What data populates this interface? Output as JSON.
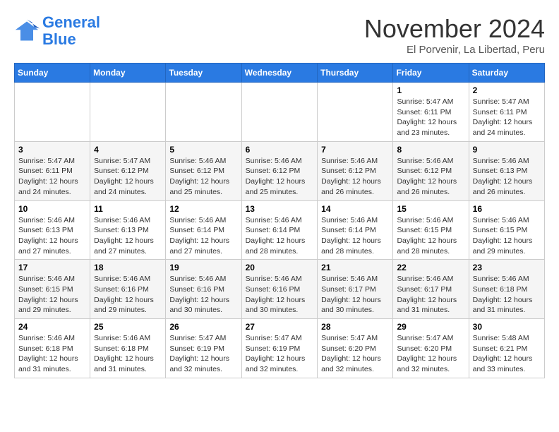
{
  "logo": {
    "line1": "General",
    "line2": "Blue"
  },
  "title": "November 2024",
  "subtitle": "El Porvenir, La Libertad, Peru",
  "days_of_week": [
    "Sunday",
    "Monday",
    "Tuesday",
    "Wednesday",
    "Thursday",
    "Friday",
    "Saturday"
  ],
  "weeks": [
    [
      {
        "day": "",
        "info": ""
      },
      {
        "day": "",
        "info": ""
      },
      {
        "day": "",
        "info": ""
      },
      {
        "day": "",
        "info": ""
      },
      {
        "day": "",
        "info": ""
      },
      {
        "day": "1",
        "info": "Sunrise: 5:47 AM\nSunset: 6:11 PM\nDaylight: 12 hours and 23 minutes."
      },
      {
        "day": "2",
        "info": "Sunrise: 5:47 AM\nSunset: 6:11 PM\nDaylight: 12 hours and 24 minutes."
      }
    ],
    [
      {
        "day": "3",
        "info": "Sunrise: 5:47 AM\nSunset: 6:11 PM\nDaylight: 12 hours and 24 minutes."
      },
      {
        "day": "4",
        "info": "Sunrise: 5:47 AM\nSunset: 6:12 PM\nDaylight: 12 hours and 24 minutes."
      },
      {
        "day": "5",
        "info": "Sunrise: 5:46 AM\nSunset: 6:12 PM\nDaylight: 12 hours and 25 minutes."
      },
      {
        "day": "6",
        "info": "Sunrise: 5:46 AM\nSunset: 6:12 PM\nDaylight: 12 hours and 25 minutes."
      },
      {
        "day": "7",
        "info": "Sunrise: 5:46 AM\nSunset: 6:12 PM\nDaylight: 12 hours and 26 minutes."
      },
      {
        "day": "8",
        "info": "Sunrise: 5:46 AM\nSunset: 6:12 PM\nDaylight: 12 hours and 26 minutes."
      },
      {
        "day": "9",
        "info": "Sunrise: 5:46 AM\nSunset: 6:13 PM\nDaylight: 12 hours and 26 minutes."
      }
    ],
    [
      {
        "day": "10",
        "info": "Sunrise: 5:46 AM\nSunset: 6:13 PM\nDaylight: 12 hours and 27 minutes."
      },
      {
        "day": "11",
        "info": "Sunrise: 5:46 AM\nSunset: 6:13 PM\nDaylight: 12 hours and 27 minutes."
      },
      {
        "day": "12",
        "info": "Sunrise: 5:46 AM\nSunset: 6:14 PM\nDaylight: 12 hours and 27 minutes."
      },
      {
        "day": "13",
        "info": "Sunrise: 5:46 AM\nSunset: 6:14 PM\nDaylight: 12 hours and 28 minutes."
      },
      {
        "day": "14",
        "info": "Sunrise: 5:46 AM\nSunset: 6:14 PM\nDaylight: 12 hours and 28 minutes."
      },
      {
        "day": "15",
        "info": "Sunrise: 5:46 AM\nSunset: 6:15 PM\nDaylight: 12 hours and 28 minutes."
      },
      {
        "day": "16",
        "info": "Sunrise: 5:46 AM\nSunset: 6:15 PM\nDaylight: 12 hours and 29 minutes."
      }
    ],
    [
      {
        "day": "17",
        "info": "Sunrise: 5:46 AM\nSunset: 6:15 PM\nDaylight: 12 hours and 29 minutes."
      },
      {
        "day": "18",
        "info": "Sunrise: 5:46 AM\nSunset: 6:16 PM\nDaylight: 12 hours and 29 minutes."
      },
      {
        "day": "19",
        "info": "Sunrise: 5:46 AM\nSunset: 6:16 PM\nDaylight: 12 hours and 30 minutes."
      },
      {
        "day": "20",
        "info": "Sunrise: 5:46 AM\nSunset: 6:16 PM\nDaylight: 12 hours and 30 minutes."
      },
      {
        "day": "21",
        "info": "Sunrise: 5:46 AM\nSunset: 6:17 PM\nDaylight: 12 hours and 30 minutes."
      },
      {
        "day": "22",
        "info": "Sunrise: 5:46 AM\nSunset: 6:17 PM\nDaylight: 12 hours and 31 minutes."
      },
      {
        "day": "23",
        "info": "Sunrise: 5:46 AM\nSunset: 6:18 PM\nDaylight: 12 hours and 31 minutes."
      }
    ],
    [
      {
        "day": "24",
        "info": "Sunrise: 5:46 AM\nSunset: 6:18 PM\nDaylight: 12 hours and 31 minutes."
      },
      {
        "day": "25",
        "info": "Sunrise: 5:46 AM\nSunset: 6:18 PM\nDaylight: 12 hours and 31 minutes."
      },
      {
        "day": "26",
        "info": "Sunrise: 5:47 AM\nSunset: 6:19 PM\nDaylight: 12 hours and 32 minutes."
      },
      {
        "day": "27",
        "info": "Sunrise: 5:47 AM\nSunset: 6:19 PM\nDaylight: 12 hours and 32 minutes."
      },
      {
        "day": "28",
        "info": "Sunrise: 5:47 AM\nSunset: 6:20 PM\nDaylight: 12 hours and 32 minutes."
      },
      {
        "day": "29",
        "info": "Sunrise: 5:47 AM\nSunset: 6:20 PM\nDaylight: 12 hours and 32 minutes."
      },
      {
        "day": "30",
        "info": "Sunrise: 5:48 AM\nSunset: 6:21 PM\nDaylight: 12 hours and 33 minutes."
      }
    ]
  ]
}
